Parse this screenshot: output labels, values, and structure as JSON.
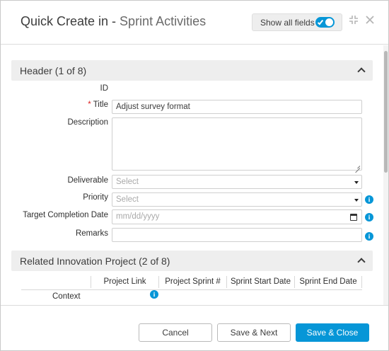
{
  "header": {
    "title": "Quick Create in - ",
    "subtitle": "Sprint Activities",
    "show_all_label": "Show all fields",
    "show_all_on": true
  },
  "sections": [
    {
      "label": "Header (1 of 8)"
    },
    {
      "label": "Related Innovation Project (2 of 8)"
    }
  ],
  "fields": {
    "id": {
      "label": "ID"
    },
    "title": {
      "label": "Title",
      "required_marker": "*",
      "value": "Adjust survey format"
    },
    "description": {
      "label": "Description",
      "value": ""
    },
    "deliverable": {
      "label": "Deliverable",
      "placeholder": "Select"
    },
    "priority": {
      "label": "Priority",
      "placeholder": "Select"
    },
    "target_date": {
      "label": "Target Completion Date",
      "placeholder": "mm/dd/yyyy"
    },
    "remarks": {
      "label": "Remarks",
      "value": ""
    }
  },
  "table": {
    "columns": [
      "Project Link",
      "Project Sprint #",
      "Sprint Start Date",
      "Sprint End Date"
    ],
    "rows": [
      {
        "label": "Context"
      }
    ]
  },
  "footer": {
    "cancel": "Cancel",
    "save_next": "Save & Next",
    "save_close": "Save & Close"
  },
  "colors": {
    "accent": "#0696d7",
    "required": "#dd2222"
  }
}
